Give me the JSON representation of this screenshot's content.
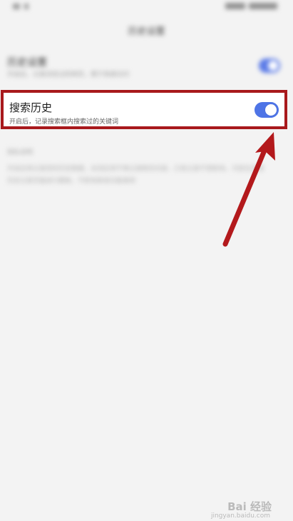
{
  "status_bar": {
    "left_icons": [
      "signal-icon",
      "wifi-icon"
    ],
    "right_icons": [
      "network-icon",
      "battery-icon"
    ]
  },
  "header": {
    "title": "历史设置"
  },
  "settings": {
    "row1": {
      "title": "历史设置",
      "subtitle": "开启后，记录浏览过的网页，便于快速访问",
      "enabled": true
    },
    "search_history": {
      "title": "搜索历史",
      "subtitle": "开启后，记录搜索框内搜索过的关键词",
      "enabled": true
    }
  },
  "section": {
    "header": "隐私说明",
    "line1": "开启后将记录您的历史数据，关闭后将不再记录新的内容，已有记录不受影响，可前往清理",
    "line2": "历史记录页面进行删除，不影响其他功能使用"
  },
  "colors": {
    "accent": "#4e74e6",
    "highlight": "#a8191c"
  },
  "watermark": {
    "brand": "Bai 经验",
    "sub": "jingyan.baidu.com"
  }
}
